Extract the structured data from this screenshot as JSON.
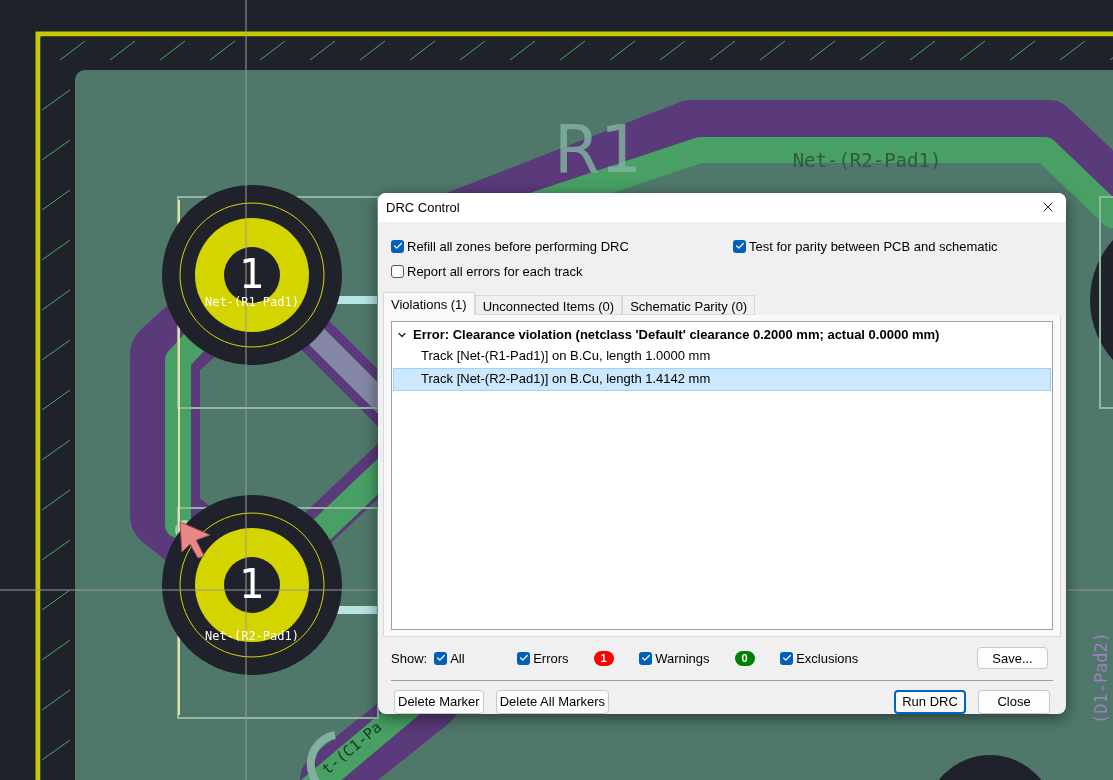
{
  "canvas": {
    "labels": [
      {
        "text": "R1",
        "kind": "reference"
      },
      {
        "text": "Net-(R2-Pad1)",
        "kind": "track_net"
      },
      {
        "text": "1",
        "kind": "pad_number"
      },
      {
        "text": "Net-(R1-Pad1)",
        "kind": "pad_net"
      },
      {
        "text": "1",
        "kind": "pad_number"
      },
      {
        "text": "Net-(R2-Pad1)",
        "kind": "pad_net"
      },
      {
        "text": "(D1-Pad2)",
        "kind": "vertical_net"
      },
      {
        "text": "t-(C1-Pa",
        "kind": "slanted_net"
      }
    ]
  },
  "dialog": {
    "title": "DRC Control",
    "options": [
      {
        "label": "Refill all zones before performing DRC",
        "checked": true
      },
      {
        "label": "Test for parity between PCB and schematic",
        "checked": true
      },
      {
        "label": "Report all errors for each track",
        "checked": false
      }
    ],
    "tabs": [
      {
        "label": "Violations (1)",
        "selected": true
      },
      {
        "label": "Unconnected Items (0)",
        "selected": false
      },
      {
        "label": "Schematic Parity (0)",
        "selected": false
      }
    ],
    "violations": [
      {
        "text": "Error: Clearance violation (netclass 'Default' clearance 0.2000 mm; actual 0.0000 mm)",
        "expanded": true,
        "items": [
          {
            "text": "Track [Net-(R1-Pad1)] on B.Cu, length 1.0000 mm",
            "selected": false
          },
          {
            "text": "Track [Net-(R2-Pad1)] on B.Cu, length 1.4142 mm",
            "selected": true
          }
        ]
      }
    ],
    "show_label": "Show:",
    "filters": [
      {
        "label": "All",
        "checked": true
      },
      {
        "label": "Errors",
        "checked": true,
        "badge": "1",
        "color": "#ff0000"
      },
      {
        "label": "Warnings",
        "checked": true,
        "badge": "0",
        "color": "#008000"
      },
      {
        "label": "Exclusions",
        "checked": true
      }
    ],
    "save_button": "Save...",
    "buttons": [
      {
        "label": "Delete Marker",
        "kind": "left"
      },
      {
        "label": "Delete All Markers",
        "kind": "left"
      },
      {
        "label": "Run DRC",
        "kind": "default"
      },
      {
        "label": "Close",
        "kind": "right"
      }
    ]
  }
}
